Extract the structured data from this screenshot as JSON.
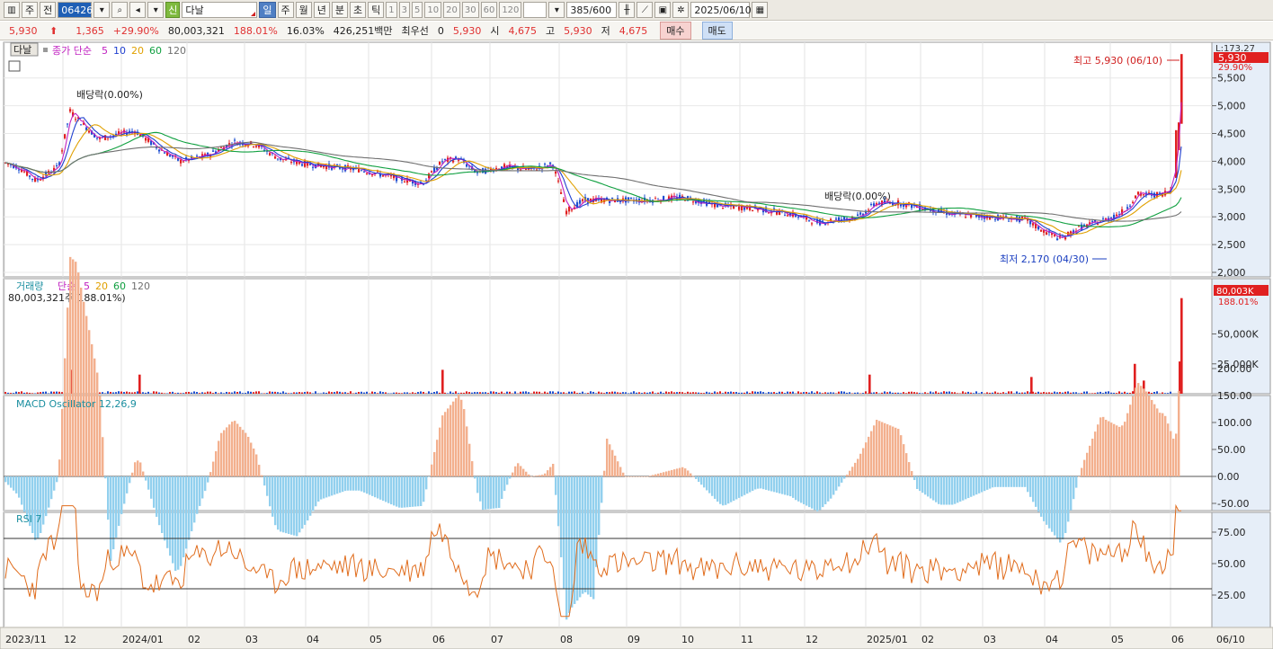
{
  "toolbar": {
    "market": "주",
    "market2": "전",
    "code": "064260",
    "badge": "신",
    "name": "다날",
    "periods": [
      "일",
      "주",
      "월",
      "년",
      "분",
      "초",
      "틱"
    ],
    "active_period": "일",
    "mins": [
      "1",
      "3",
      "5",
      "10",
      "20",
      "30",
      "60",
      "120"
    ],
    "count": "385",
    "count_max": "/600",
    "date": "2025/06/10"
  },
  "quote": {
    "price": "5,930",
    "change": "1,365",
    "change_pct": "+29.90%",
    "volume": "80,003,321",
    "vol_ratio": "188.01%",
    "turnover": "16.03%",
    "amount": "426,251백만",
    "pref_label": "최우선",
    "pref_qty": "0",
    "pref_price": "5,930",
    "open_label": "시",
    "open": "4,675",
    "high_label": "고",
    "high": "5,930",
    "low_label": "저",
    "low": "4,675",
    "buy": "매수",
    "sell": "매도"
  },
  "price_panel": {
    "name_tag": "다날",
    "legend": "종가 단순",
    "ma": [
      "5",
      "10",
      "20",
      "60",
      "120"
    ],
    "ma_colors": [
      "#c020c0",
      "#2040d0",
      "#e0a000",
      "#10a040",
      "#707070"
    ],
    "dividend_label_1": "배당락(0.00%)",
    "dividend_label_2": "배당락(0.00%)",
    "high_note": "최고 5,930 (06/10)",
    "low_note": "최저 2,170 (04/30)",
    "scale_top": "L:173.27",
    "last_price": "5,930",
    "last_pct": "29.90%",
    "ticks": [
      "5,500",
      "5,000",
      "4,500",
      "4,000",
      "3,500",
      "3,000",
      "2,500",
      "2,000"
    ]
  },
  "volume_panel": {
    "legend": "거래량",
    "ma_legend": "단순",
    "ma": [
      "5",
      "20",
      "60",
      "120"
    ],
    "ma_colors": [
      "#c020c0",
      "#e0a000",
      "#10a040",
      "#707070"
    ],
    "value": "80,003,321주(188.01%)",
    "last": "80,003K",
    "last_pct": "188.01%",
    "ticks": [
      "50,000K",
      "25,000K"
    ]
  },
  "macd_panel": {
    "legend": "MACD Oscillator 12,26,9",
    "ticks": [
      "200.00",
      "150.00",
      "100.00",
      "50.00",
      "0.00",
      "-50.00"
    ]
  },
  "rsi_panel": {
    "legend": "RSI 7",
    "ticks": [
      "75.00",
      "50.00",
      "25.00"
    ]
  },
  "x_axis": [
    "2023/11",
    "12",
    "2024/01",
    "02",
    "03",
    "04",
    "05",
    "06",
    "07",
    "08",
    "09",
    "10",
    "11",
    "12",
    "2025/01",
    "02",
    "03",
    "04",
    "05",
    "06",
    "06/10"
  ],
  "chart_data": {
    "type": "candlestick",
    "ylim": [
      2000,
      5900
    ],
    "anchors": [
      [
        0,
        4000
      ],
      [
        20,
        3900
      ],
      [
        40,
        3650
      ],
      [
        65,
        3900
      ],
      [
        78,
        4900
      ],
      [
        90,
        4700
      ],
      [
        110,
        4400
      ],
      [
        135,
        4500
      ],
      [
        150,
        4550
      ],
      [
        175,
        4250
      ],
      [
        200,
        4000
      ],
      [
        230,
        4100
      ],
      [
        260,
        4350
      ],
      [
        285,
        4300
      ],
      [
        310,
        4050
      ],
      [
        340,
        3950
      ],
      [
        370,
        3900
      ],
      [
        400,
        3850
      ],
      [
        440,
        3700
      ],
      [
        470,
        3600
      ],
      [
        492,
        4000
      ],
      [
        510,
        4050
      ],
      [
        530,
        3800
      ],
      [
        560,
        3900
      ],
      [
        590,
        3850
      ],
      [
        615,
        3950
      ],
      [
        630,
        3100
      ],
      [
        650,
        3300
      ],
      [
        690,
        3300
      ],
      [
        720,
        3300
      ],
      [
        760,
        3350
      ],
      [
        800,
        3200
      ],
      [
        840,
        3150
      ],
      [
        880,
        3050
      ],
      [
        910,
        2900
      ],
      [
        930,
        2950
      ],
      [
        955,
        3000
      ],
      [
        975,
        3250
      ],
      [
        1000,
        3250
      ],
      [
        1030,
        3150
      ],
      [
        1060,
        3050
      ],
      [
        1100,
        3000
      ],
      [
        1140,
        2950
      ],
      [
        1160,
        2750
      ],
      [
        1180,
        2600
      ],
      [
        1200,
        2800
      ],
      [
        1230,
        2950
      ],
      [
        1250,
        3100
      ],
      [
        1265,
        3400
      ],
      [
        1290,
        3400
      ],
      [
        1305,
        3500
      ],
      [
        1312,
        4600
      ],
      [
        1314,
        5930
      ]
    ],
    "volume_spikes": [
      [
        80,
        20000
      ],
      [
        78,
        9000
      ],
      [
        155,
        16000
      ],
      [
        492,
        20000
      ],
      [
        967,
        16000
      ],
      [
        1147,
        14000
      ],
      [
        1262,
        25000
      ],
      [
        1272,
        11000
      ],
      [
        1312,
        27000
      ],
      [
        1314,
        80003
      ]
    ],
    "rsi_last": 92,
    "macd_last": 185
  }
}
